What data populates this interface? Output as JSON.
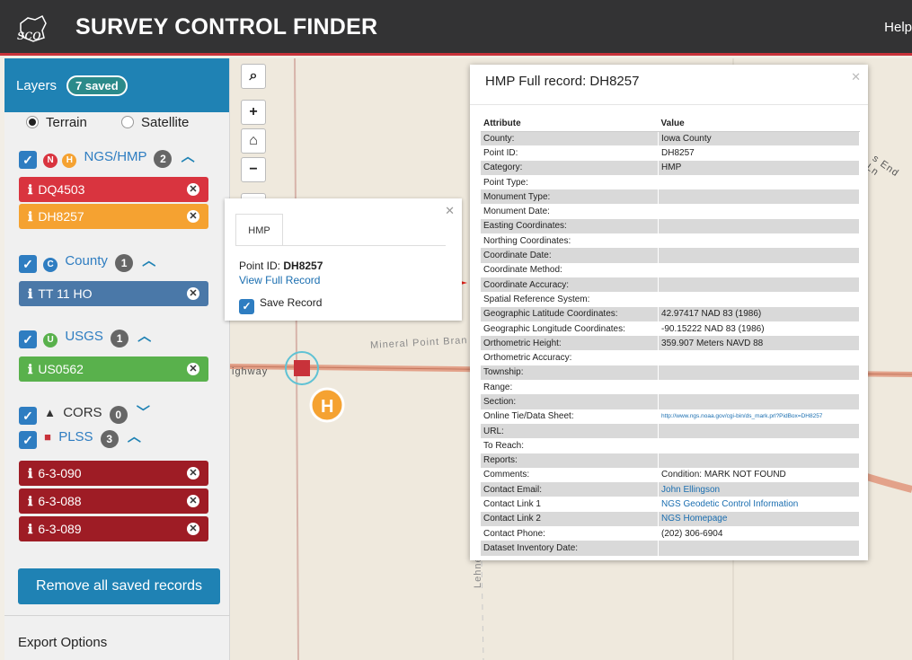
{
  "header": {
    "title": "SURVEY CONTROL FINDER",
    "logo_text": "sco",
    "help": "Help"
  },
  "sidebar": {
    "layers_label": "Layers",
    "saved_badge": "7 saved",
    "basemap": {
      "terrain": "Terrain",
      "satellite": "Satellite",
      "selected": "Terrain"
    },
    "groups": [
      {
        "name": "NGS/HMP",
        "count": "2",
        "icons": [
          "N",
          "H"
        ],
        "records": [
          {
            "label": "DQ4503",
            "color": "#d9343f"
          },
          {
            "label": "DH8257",
            "color": "#f5a231"
          }
        ]
      },
      {
        "name": "County",
        "count": "1",
        "icons": [
          "C"
        ],
        "records": [
          {
            "label": "TT 11 HO",
            "color": "#4a78a8"
          }
        ]
      },
      {
        "name": "USGS",
        "count": "1",
        "icons": [
          "U"
        ],
        "records": [
          {
            "label": "US0562",
            "color": "#59b14c"
          }
        ]
      },
      {
        "name": "CORS",
        "count": "0",
        "icons": [
          "triangle"
        ],
        "records": []
      },
      {
        "name": "PLSS",
        "count": "3",
        "icons": [
          "square"
        ],
        "records": [
          {
            "label": "6-3-090",
            "color": "#9e1c25"
          },
          {
            "label": "6-3-088",
            "color": "#9e1c25"
          },
          {
            "label": "6-3-089",
            "color": "#9e1c25"
          }
        ]
      }
    ],
    "remove_button": "Remove all saved records",
    "export_label": "Export Options"
  },
  "map": {
    "road_labels": [
      "Mineral Point Bran",
      "ighway",
      "Lehner Rd",
      "s End Ln"
    ]
  },
  "popup": {
    "tab": "HMP",
    "point_id_label": "Point ID:",
    "point_id": "DH8257",
    "view_link": "View Full Record",
    "save_label": "Save Record"
  },
  "record": {
    "title": "HMP Full record: DH8257",
    "columns": [
      "Attribute",
      "Value"
    ],
    "rows": [
      [
        "County:",
        "Iowa County"
      ],
      [
        "Point ID:",
        "DH8257"
      ],
      [
        "Category:",
        "HMP"
      ],
      [
        "Point Type:",
        ""
      ],
      [
        "Monument Type:",
        ""
      ],
      [
        "Monument Date:",
        ""
      ],
      [
        "Easting Coordinates:",
        ""
      ],
      [
        "Northing Coordinates:",
        ""
      ],
      [
        "Coordinate Date:",
        ""
      ],
      [
        "Coordinate Method:",
        ""
      ],
      [
        "Coordinate Accuracy:",
        ""
      ],
      [
        "Spatial Reference System:",
        ""
      ],
      [
        "Geographic Latitude Coordinates:",
        "42.97417 NAD 83 (1986)"
      ],
      [
        "Geographic Longitude Coordinates:",
        "-90.15222 NAD 83 (1986)"
      ],
      [
        "Orthometric Height:",
        "359.907 Meters NAVD 88"
      ],
      [
        "Orthometric Accuracy:",
        ""
      ],
      [
        "Township:",
        ""
      ],
      [
        "Range:",
        ""
      ],
      [
        "Section:",
        ""
      ],
      [
        "Online Tie/Data Sheet:",
        "http://www.ngs.noaa.gov/cgi-bin/ds_mark.prl?PidBox=DH8257"
      ],
      [
        "URL:",
        ""
      ],
      [
        "To Reach:",
        ""
      ],
      [
        "Reports:",
        ""
      ],
      [
        "Comments:",
        "Condition: MARK NOT FOUND"
      ],
      [
        "Contact Email:",
        "John Ellingson"
      ],
      [
        "Contact Link 1",
        "NGS Geodetic Control Information"
      ],
      [
        "Contact Link 2",
        "NGS Homepage"
      ],
      [
        "Contact Phone:",
        "(202) 306-6904"
      ],
      [
        "Dataset Inventory Date:",
        ""
      ]
    ],
    "link_rows": [
      19,
      24,
      25,
      26
    ]
  }
}
